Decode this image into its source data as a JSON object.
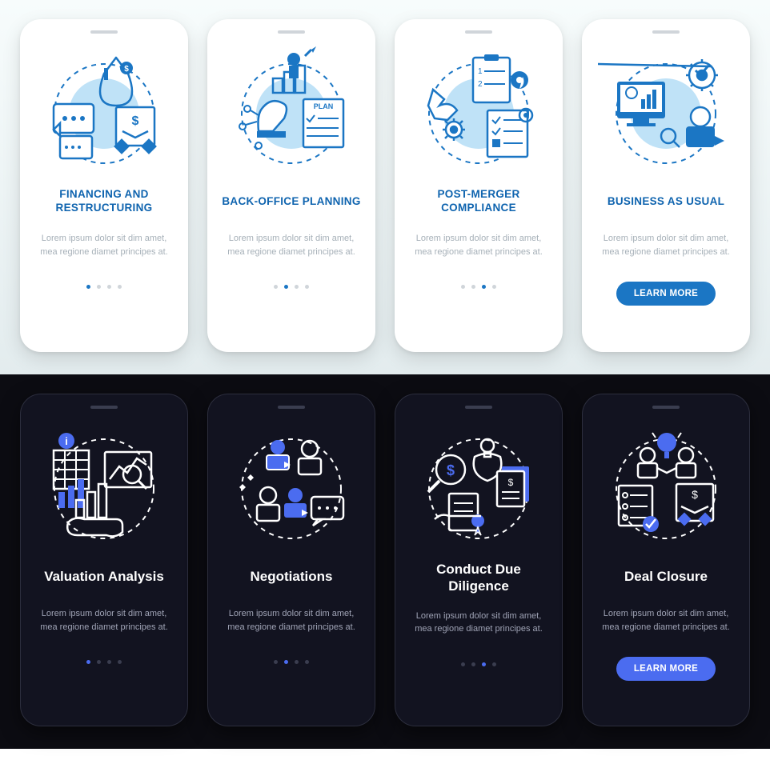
{
  "light": {
    "cards": [
      {
        "title": "FINANCING AND RESTRUCTURING",
        "desc": "Lorem ipsum dolor sit dim amet, mea regione diamet principes at.",
        "activeDot": 0,
        "icon": "money-bag-handshake"
      },
      {
        "title": "BACK-OFFICE PLANNING",
        "desc": "Lorem ipsum dolor sit dim amet, mea regione diamet principes at.",
        "activeDot": 1,
        "icon": "chess-plan"
      },
      {
        "title": "POST-MERGER COMPLIANCE",
        "desc": "Lorem ipsum dolor sit dim amet, mea regione diamet principes at.",
        "activeDot": 2,
        "icon": "clipboard-gears"
      },
      {
        "title": "BUSINESS AS USUAL",
        "desc": "Lorem ipsum dolor sit dim amet, mea regione diamet principes at.",
        "activeDot": 3,
        "icon": "monitor-gear-check",
        "cta": "LEARN MORE"
      }
    ]
  },
  "dark": {
    "cards": [
      {
        "title": "Valuation Analysis",
        "desc": "Lorem ipsum dolor sit dim amet, mea regione diamet principes at.",
        "activeDot": 0,
        "icon": "chart-hand-search"
      },
      {
        "title": "Negotiations",
        "desc": "Lorem ipsum dolor sit dim amet, mea regione diamet principes at.",
        "activeDot": 1,
        "icon": "people-chat"
      },
      {
        "title": "Conduct Due Diligence",
        "desc": "Lorem ipsum dolor sit dim amet, mea regione diamet principes at.",
        "activeDot": 2,
        "icon": "magnifier-dollar-docs"
      },
      {
        "title": "Deal Closure",
        "desc": "Lorem ipsum dolor sit dim amet, mea regione diamet principes at.",
        "activeDot": 3,
        "icon": "handshake-checklist",
        "cta": "LEARN MORE"
      }
    ]
  },
  "colors": {
    "lightAccent": "#1b76c4",
    "lightFill": "#bfe2f7",
    "darkAccent": "#4b6cf0",
    "darkStroke": "#ffffff"
  }
}
